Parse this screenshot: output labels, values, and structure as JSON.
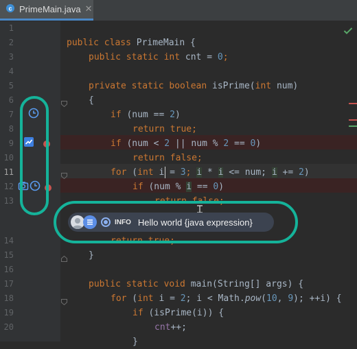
{
  "tab": {
    "title": "PrimeMain.java",
    "close": "✕"
  },
  "colors": {
    "accent": "#15b39a",
    "keyword": "#cc7832",
    "number": "#6897bb",
    "text": "#a9b7c6"
  },
  "line_numbers": [
    "1",
    "2",
    "3",
    "4",
    "5",
    "6",
    "7",
    "8",
    "9",
    "10",
    "11",
    "12",
    "13",
    "14",
    "15",
    "16",
    "17",
    "18",
    "19",
    "20"
  ],
  "code": {
    "l2": [
      "public class PrimeMain {"
    ],
    "l3a": "public static int",
    "l3b": " cnt = ",
    "l3c": "0",
    "l3d": ";",
    "l5a": "private static boolean",
    "l5b": " isPrime(",
    "l5c": "int",
    "l5d": " num)",
    "l6": "{",
    "l7a": "if",
    "l7b": " (num == ",
    "l7c": "2",
    "l7d": ")",
    "l8a": "return true",
    "l8b": ";",
    "l9a": "if",
    "l9b": " (num < ",
    "l9c": "2",
    "l9d": " || num % ",
    "l9e": "2",
    "l9f": " == ",
    "l9g": "0",
    "l9h": ")",
    "l10a": "return false",
    "l10b": ";",
    "l11a": "for",
    "l11b": " (",
    "l11c": "int",
    "l11d": " i",
    "l11e": " = ",
    "l11f": "3",
    "l11g": "; ",
    "l11h": "i",
    "l11i": " * ",
    "l11j": "i",
    "l11k": " <= num; ",
    "l11l": "i",
    "l11m": " += ",
    "l11n": "2",
    "l11o": ")",
    "l12a": "if",
    "l12b": " (num % ",
    "l12c": "i",
    "l12d": " == ",
    "l12e": "0",
    "l12f": ")",
    "l13a": "return false",
    "l13b": ";",
    "l14a": "return true",
    "l14b": ";",
    "l15": "}",
    "l17a": "public static void",
    "l17b": " main(String[] args) {",
    "l18a": "for",
    "l18b": " (",
    "l18c": "int",
    "l18d": " i = ",
    "l18e": "2",
    "l18f": "; i < Math.",
    "l18g": "pow",
    "l18h": "(",
    "l18i": "10",
    "l18j": ", ",
    "l18k": "9",
    "l18l": "); ++i) {",
    "l19a": "if",
    "l19b": " (isPrime(i)) {",
    "l20a": "cnt",
    "l20b": "++;",
    "l21": "}"
  },
  "popup": {
    "badge": "INFO",
    "message": "Hello world {java expression}"
  },
  "icons": {
    "line7": "clock-icon",
    "line9": "chart-icon",
    "line12": [
      "camera-icon",
      "clock-icon"
    ],
    "check": "check-icon"
  }
}
